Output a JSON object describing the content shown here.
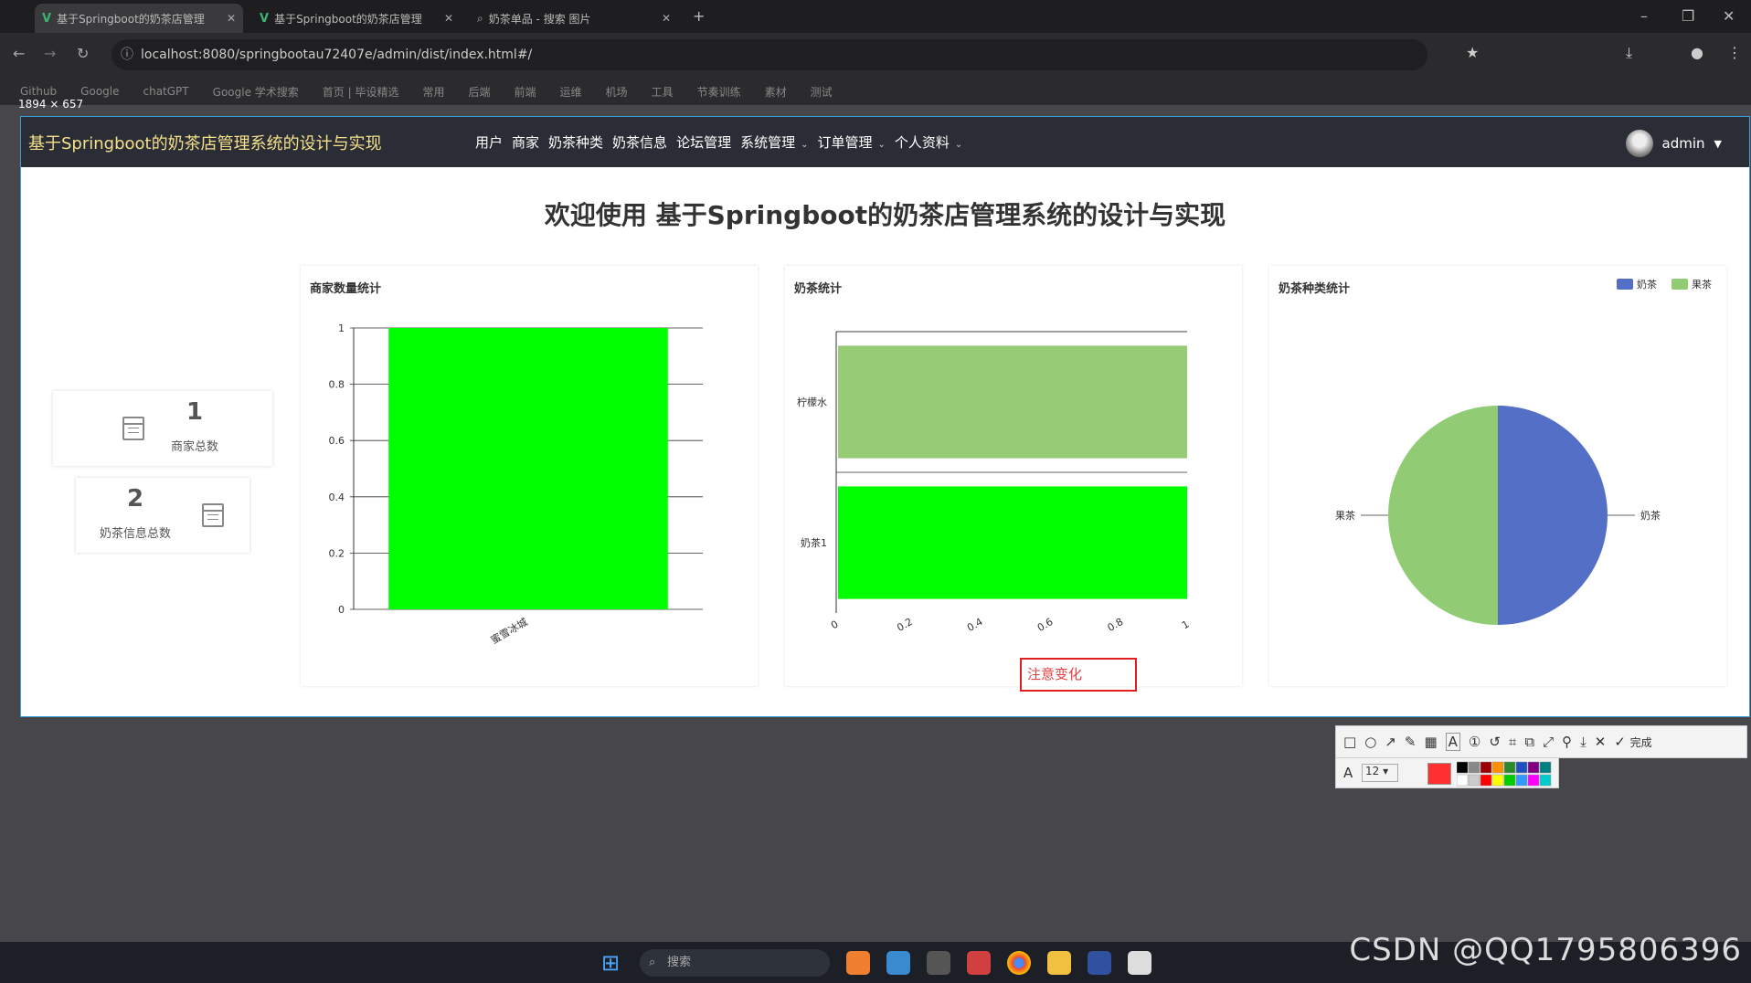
{
  "browser": {
    "tabs": [
      {
        "label": "基于Springboot的奶茶店管理"
      },
      {
        "label": "基于Springboot的奶茶店管理"
      },
      {
        "label": "奶茶单品 - 搜索 图片"
      }
    ],
    "url": "localhost:8080/springbootau72407e/admin/dist/index.html#/",
    "bookmarks": [
      "Github",
      "Google",
      "chatGPT",
      "Google 学术搜索",
      "首页 | 毕设精选",
      "常用",
      "后端",
      "前端",
      "运维",
      "机场",
      "工具",
      "节奏训练",
      "素材",
      "测试"
    ],
    "dimensions": "1894 × 657"
  },
  "app": {
    "title": "基于Springboot的奶茶店管理系统的设计与实现",
    "menu": [
      {
        "label": "用户"
      },
      {
        "label": "商家"
      },
      {
        "label": "奶茶种类"
      },
      {
        "label": "奶茶信息"
      },
      {
        "label": "论坛管理"
      },
      {
        "label": "系统管理",
        "dropdown": true
      },
      {
        "label": "订单管理",
        "dropdown": true
      },
      {
        "label": "个人资料",
        "dropdown": true
      }
    ],
    "user": "admin",
    "welcome": "欢迎使用 基于Springboot的奶茶店管理系统的设计与实现",
    "stats": [
      {
        "value": "1",
        "label": "商家总数"
      },
      {
        "value": "2",
        "label": "奶茶信息总数"
      }
    ],
    "change_text": "注意变化"
  },
  "chart_data": [
    {
      "type": "bar",
      "title": "商家数量统计",
      "categories": [
        "蜜雪冰城"
      ],
      "values": [
        1
      ],
      "ylim": [
        0,
        1
      ],
      "yticks": [
        "0",
        "0.2",
        "0.4",
        "0.6",
        "0.8",
        "1"
      ],
      "grid": true,
      "color": "#00ff00"
    },
    {
      "type": "bar",
      "orientation": "horizontal",
      "title": "奶茶统计",
      "categories": [
        "奶茶1",
        "柠檬水"
      ],
      "values": [
        1,
        1
      ],
      "xlim": [
        0,
        1
      ],
      "xticks": [
        "0",
        "0.2",
        "0.4",
        "0.6",
        "0.8",
        "1"
      ],
      "colors": [
        "#00ff00",
        "#96cc75"
      ]
    },
    {
      "type": "pie",
      "title": "奶茶种类统计",
      "labels": [
        "奶茶",
        "果茶"
      ],
      "values": [
        1,
        1
      ],
      "colors": [
        "#5470c6",
        "#91cc75"
      ],
      "legend": "top-right"
    }
  ],
  "toolbar": {
    "done": "完成",
    "font_size": "12"
  },
  "taskbar": {
    "search": "搜索"
  },
  "watermark": "CSDN @QQ1795806396"
}
